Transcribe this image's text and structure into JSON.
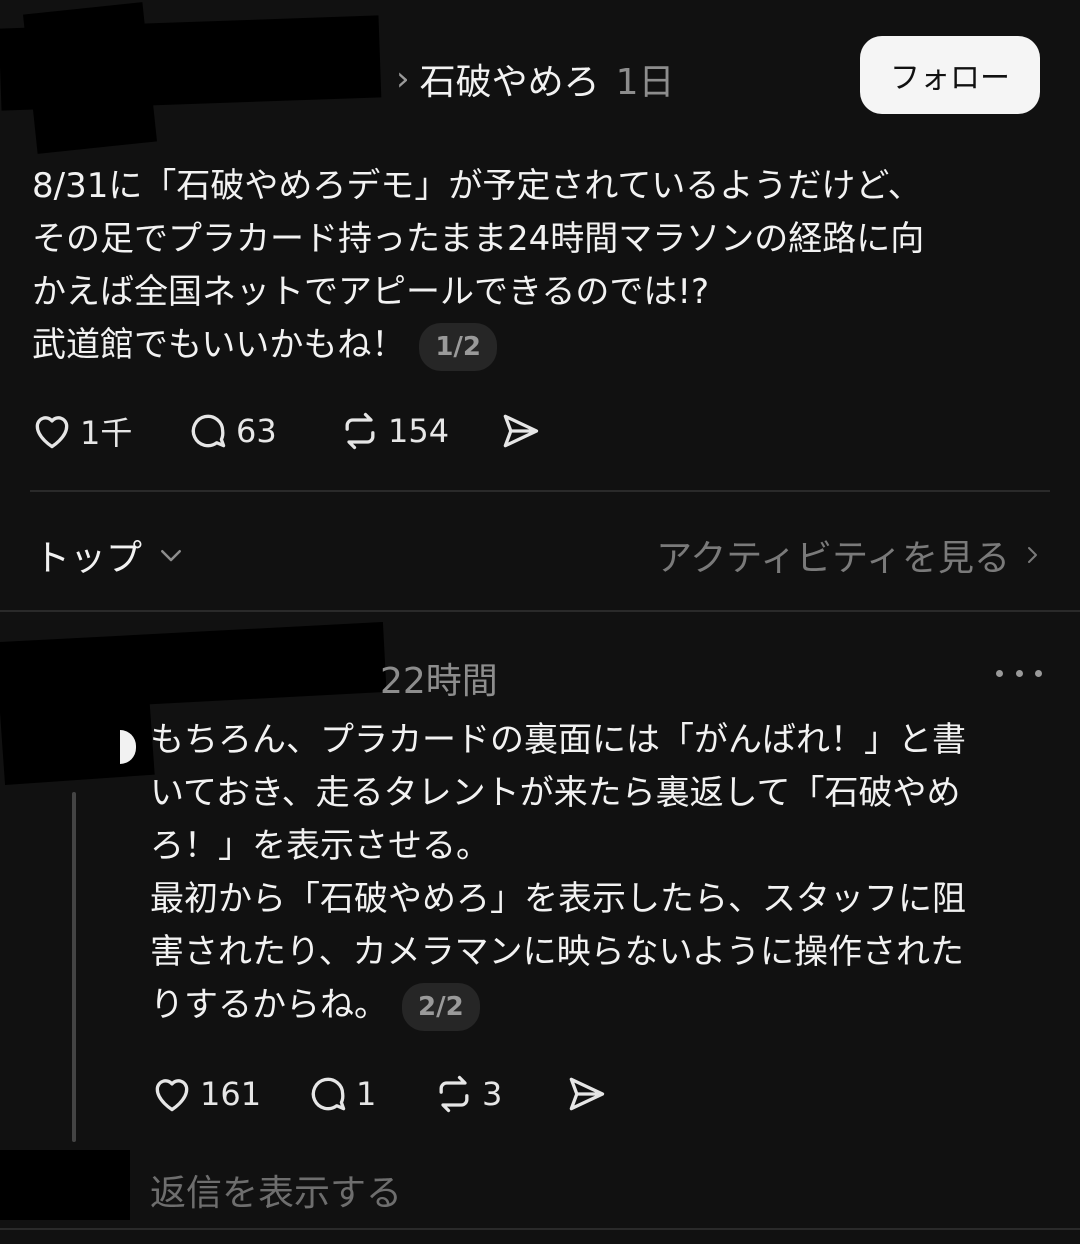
{
  "post": {
    "topic": "石破やめろ",
    "time": "1日",
    "follow_label": "フォロー",
    "lines": [
      "8/31に「石破やめろデモ」が予定されているようだけど、",
      "その足でプラカード持ったまま24時間マラソンの経路に向",
      "かえば全国ネットでアピールできるのでは!?",
      "武道館でもいいかもね！"
    ],
    "page_indicator": "1/2",
    "likes": "1千",
    "comments": "63",
    "reposts": "154"
  },
  "sort": {
    "label": "トップ",
    "activity_label": "アクティビティを見る"
  },
  "reply": {
    "time": "22時間",
    "lines": [
      "もちろん、プラカードの裏面には「がんばれ！」と書",
      "いておき、走るタレントが来たら裏返して「石破やめ",
      "ろ！」を表示させる。",
      "最初から「石破やめろ」を表示したら、スタッフに阻",
      "害されたり、カメラマンに映らないように操作された",
      "りするからね。"
    ],
    "page_indicator": "2/2",
    "likes": "161",
    "comments": "1",
    "reposts": "3",
    "show_replies_label": "返信を表示する"
  },
  "icons": [
    "heart-icon",
    "comment-icon",
    "repost-icon",
    "share-icon",
    "chevron-right-icon",
    "chevron-down-icon",
    "more-icon"
  ]
}
